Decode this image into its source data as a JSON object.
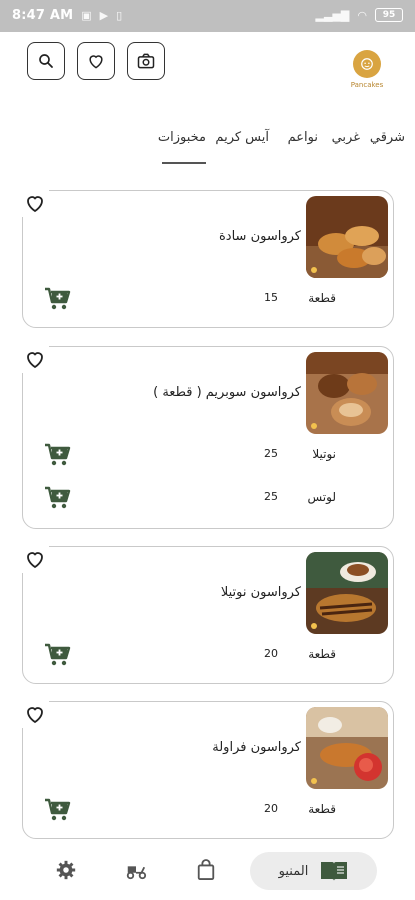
{
  "status_bar": {
    "time": "8:47 AM",
    "battery": "95"
  },
  "header": {
    "logo_text": "Pancakes"
  },
  "categories": [
    {
      "label": "شرقي"
    },
    {
      "label": "غربي"
    },
    {
      "label": "نواعم"
    },
    {
      "label": "آيس كريم"
    },
    {
      "label": "مخبوزات",
      "active": true
    }
  ],
  "products": [
    {
      "name": "كرواسون سادة",
      "options": [
        {
          "label": "قطعة",
          "price": "15"
        }
      ],
      "thumb_colors": [
        "#c27a2e",
        "#e5a45a"
      ]
    },
    {
      "name": "كرواسون سوبريم ( قطعة )",
      "options": [
        {
          "label": "نوتيلا",
          "price": "25"
        },
        {
          "label": "لوتس",
          "price": "25"
        }
      ],
      "thumb_colors": [
        "#8c4b1f",
        "#d89a55"
      ]
    },
    {
      "name": "كرواسون نوتيلا",
      "options": [
        {
          "label": "قطعة",
          "price": "20"
        }
      ],
      "thumb_colors": [
        "#7a4a24",
        "#c78a4a"
      ]
    },
    {
      "name": "كرواسون فراولة",
      "options": [
        {
          "label": "قطعة",
          "price": "20"
        }
      ],
      "thumb_colors": [
        "#a3541f",
        "#d3342f"
      ]
    }
  ],
  "bottom_nav": {
    "menu_label": "المنيو"
  },
  "colors": {
    "accent": "#3f5a3e",
    "brand": "#d9a441"
  }
}
